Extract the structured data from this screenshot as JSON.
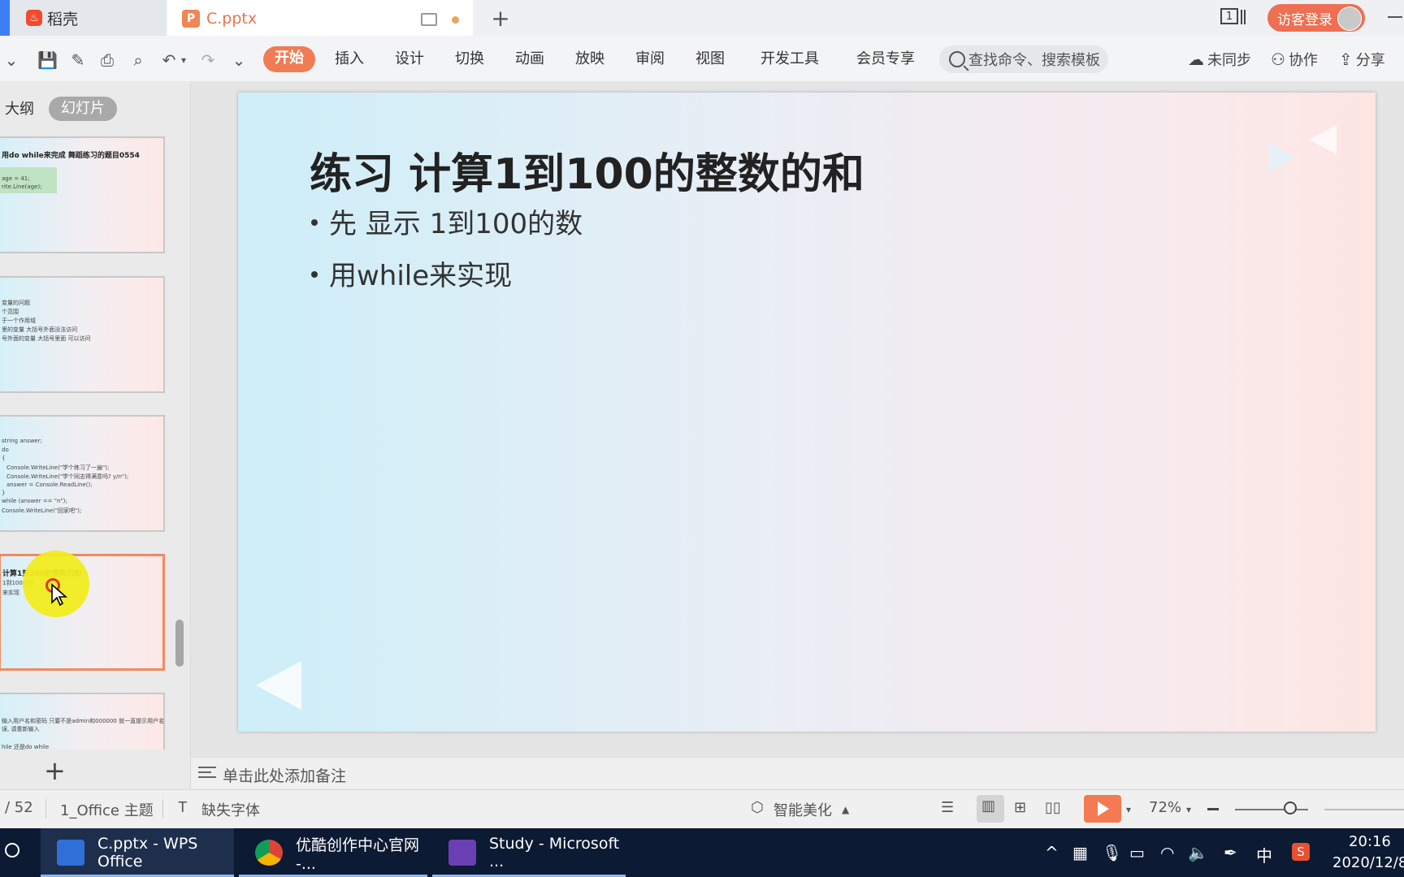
{
  "tabs": {
    "home": "稻壳",
    "file": "C.pptx"
  },
  "header": {
    "window_count": "1",
    "login": "访客登录"
  },
  "ribbon": {
    "menus": [
      "开始",
      "插入",
      "设计",
      "切换",
      "动画",
      "放映",
      "审阅",
      "视图",
      "开发工具",
      "会员专享"
    ],
    "search_placeholder": "查找命令、搜索模板",
    "actions": {
      "sync": "未同步",
      "collaborate": "协作",
      "share": "分享"
    }
  },
  "left_panel": {
    "tabs": [
      "大纲",
      "幻灯片"
    ],
    "thumbs": [
      {
        "lines": [
          "用do while来完成 舞蹈练习的题目0554",
          "age = 41;",
          "rite.Line(age);"
        ]
      },
      {
        "lines": [
          "变量的问题",
          "个范围",
          "于一个作用域",
          "里的变量 大括号外面没法访问",
          "号外面的变量 大括号里面 可以访问"
        ]
      },
      {
        "lines": [
          "string answer;",
          "do",
          "{",
          "Console.WriteLine(\"学个练习了一遍\");",
          "Console.WriteLine(\"学个同志得满意吗? y/n\");",
          "answer = Console.ReadLine();",
          "}",
          "while (answer == \"n\");",
          "Console.WriteLine(\"回家吧\");"
        ]
      },
      {
        "lines": [
          "计算1到100的整数的和",
          "1到100的数",
          "来实现"
        ]
      },
      {
        "lines": [
          "输入用户名和密码 只要不是admin和000000 就一直提示用户名",
          "误, 请重新输入",
          "hile 还是do while"
        ]
      }
    ]
  },
  "slide": {
    "title": "练习 计算1到100的整数的和",
    "bullets": [
      "先 显示 1到100的数",
      "用while来实现"
    ]
  },
  "notes": {
    "placeholder": "单击此处添加备注"
  },
  "statusbar": {
    "page": "/ 52",
    "theme": "1_Office 主题",
    "missing_font": "缺失字体",
    "beautify": "智能美化",
    "zoom": "72%"
  },
  "taskbar": {
    "items": [
      {
        "label": "C.pptx - WPS Office"
      },
      {
        "label": "优酷创作中心官网 -..."
      },
      {
        "label": "Study - Microsoft ..."
      }
    ],
    "ime": "中",
    "time": "20:16",
    "date": "2020/12/8"
  },
  "colors": {
    "accent": "#f07c53",
    "taskbar": "#0c1a33"
  }
}
